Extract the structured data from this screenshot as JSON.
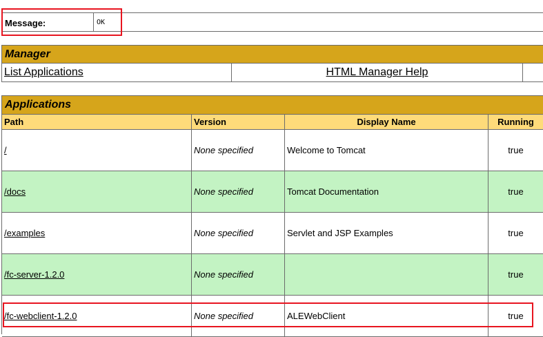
{
  "message": {
    "label": "Message:",
    "value": "OK"
  },
  "manager": {
    "title": "Manager",
    "links": [
      "List Applications",
      "HTML Manager Help"
    ]
  },
  "applications": {
    "title": "Applications",
    "columns": [
      "Path",
      "Version",
      "Display Name",
      "Running"
    ],
    "rows": [
      {
        "path": "/",
        "version": "None specified",
        "display_name": "Welcome to Tomcat",
        "running": "true"
      },
      {
        "path": "/docs",
        "version": "None specified",
        "display_name": "Tomcat Documentation",
        "running": "true"
      },
      {
        "path": "/examples",
        "version": "None specified",
        "display_name": "Servlet and JSP Examples",
        "running": "true"
      },
      {
        "path": "/fc-server-1.2.0",
        "version": "None specified",
        "display_name": "",
        "running": "true"
      },
      {
        "path": "/fc-webclient-1.2.0",
        "version": "None specified",
        "display_name": "ALEWebClient",
        "running": "true"
      }
    ]
  },
  "colors": {
    "section_header": "#d6a51b",
    "column_header": "#fedb7a",
    "alt_row": "#c3f3c3",
    "highlight": "#e8141f"
  }
}
